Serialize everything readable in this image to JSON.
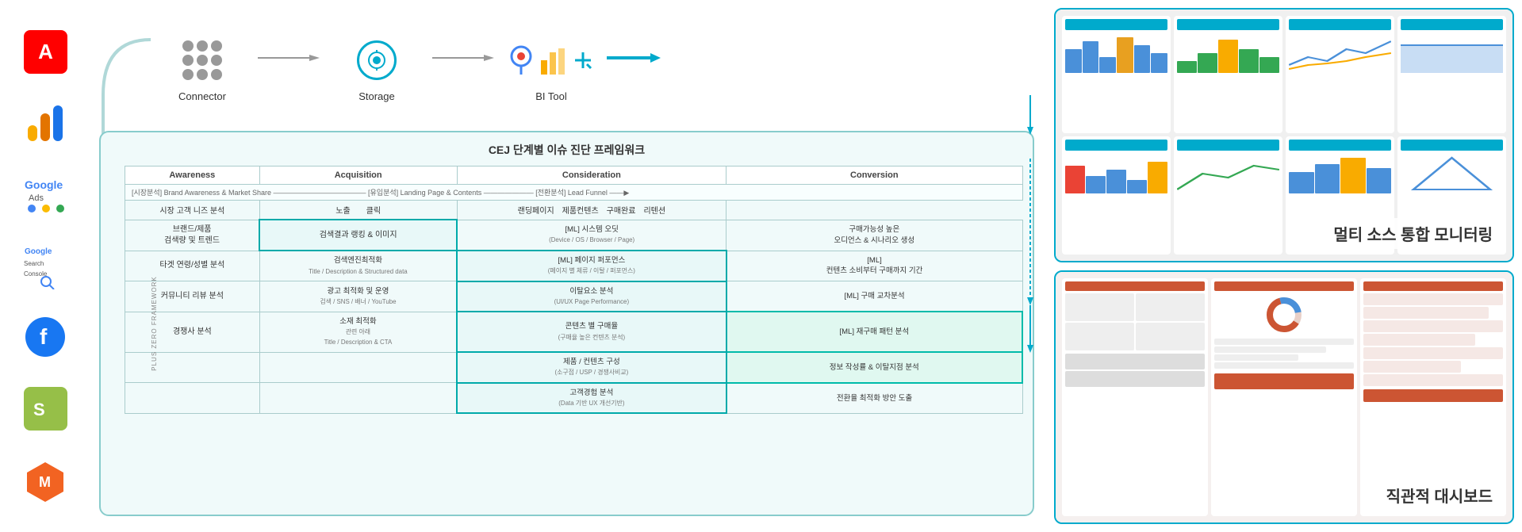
{
  "page": {
    "title": "CEJ 단계별 이슈 진단 프레임워크"
  },
  "sidebar": {
    "logos": [
      {
        "name": "adobe",
        "label": "Adobe"
      },
      {
        "name": "google-analytics",
        "label": "Google Analytics"
      },
      {
        "name": "google-ads",
        "label": "Google Ads"
      },
      {
        "name": "google-search-console",
        "label": "Google Search Console"
      },
      {
        "name": "facebook",
        "label": "Facebook"
      },
      {
        "name": "shopify",
        "label": "Shopify"
      },
      {
        "name": "magento",
        "label": "Magento"
      }
    ]
  },
  "pipeline": {
    "connector_label": "Connector",
    "storage_label": "Storage",
    "bi_tool_label": "BI Tool"
  },
  "framework": {
    "title": "CEJ 단계별 이슈 진단 프레임워크",
    "plus_zero_label": "PLUS ZERO FRAMEWORK",
    "headers": [
      "Awareness",
      "Acquisition",
      "Consideration",
      "Conversion"
    ],
    "subheader": "[시장분석] Brand Awareness & Market Share ————————————— [유입분석] Landing Page & Contents ——————— [전환분석] Lead Funnel ——▶",
    "labels": [
      "시장 고객 니즈 분석",
      "노출",
      "클릭",
      "랜딩페이지",
      "제품컨텐츠",
      "구매완료",
      "리텐션"
    ],
    "rows": [
      {
        "col1": "브랜드/제품\n검색량 및 트렌드",
        "col2": "검색결과 랭킹 & 이미지",
        "col3": "[ML] 시스템 오딧\n(Device / OS / Browser / Page)",
        "col4": "구매가능성 높은\n오디언스 & 시나리오 생성",
        "col2_highlight": true
      },
      {
        "col1": "타겟 연령/성별 분석",
        "col2": "검색엔진최적화\nTitle / Description & Structured data",
        "col3": "[ML] 페이지 퍼포먼스\n(페이지 별 체류 / 이탈 / 퍼포먼스)",
        "col4": "[ML]\n컨텐츠 소비부터 구매까지 기간",
        "col3_highlight": true
      },
      {
        "col1": "커뮤니티 리뷰 분석",
        "col2": "광고 최적화 및 운영\n검색 / SNS / 배너 / YouTube",
        "col3": "이탈요소 분석\n(UI/UX Page Performance)",
        "col4": "[ML] 구매 교차분석",
        "col3_highlight": true
      },
      {
        "col1": "경쟁사 분석",
        "col2": "소재 최적화\n관련 아래\nTitle / Description & CTA",
        "col3": "콘텐츠 별 구매율\n(구매율 높은 컨텐츠 분석)",
        "col4": "[ML] 재구매 패턴 분석",
        "col3_highlight": true,
        "col4_highlight": true
      },
      {
        "col1": "",
        "col2": "",
        "col3": "제품 / 컨텐츠 구성\n(소구점 / USP / 경쟁사비교)",
        "col4": "정보 작성률 & 이탈지점 분석",
        "col3_highlight": true,
        "col4_highlight": true
      },
      {
        "col1": "",
        "col2": "",
        "col3": "고객경험 분석\n(Data 기반 UX 개선기반)",
        "col4": "전환율 최적화 방안 도출",
        "col3_highlight": true
      }
    ]
  },
  "right_panel": {
    "top_title": "멀티 소스 통합 모니터링",
    "bottom_title": "직관적 대시보드"
  }
}
